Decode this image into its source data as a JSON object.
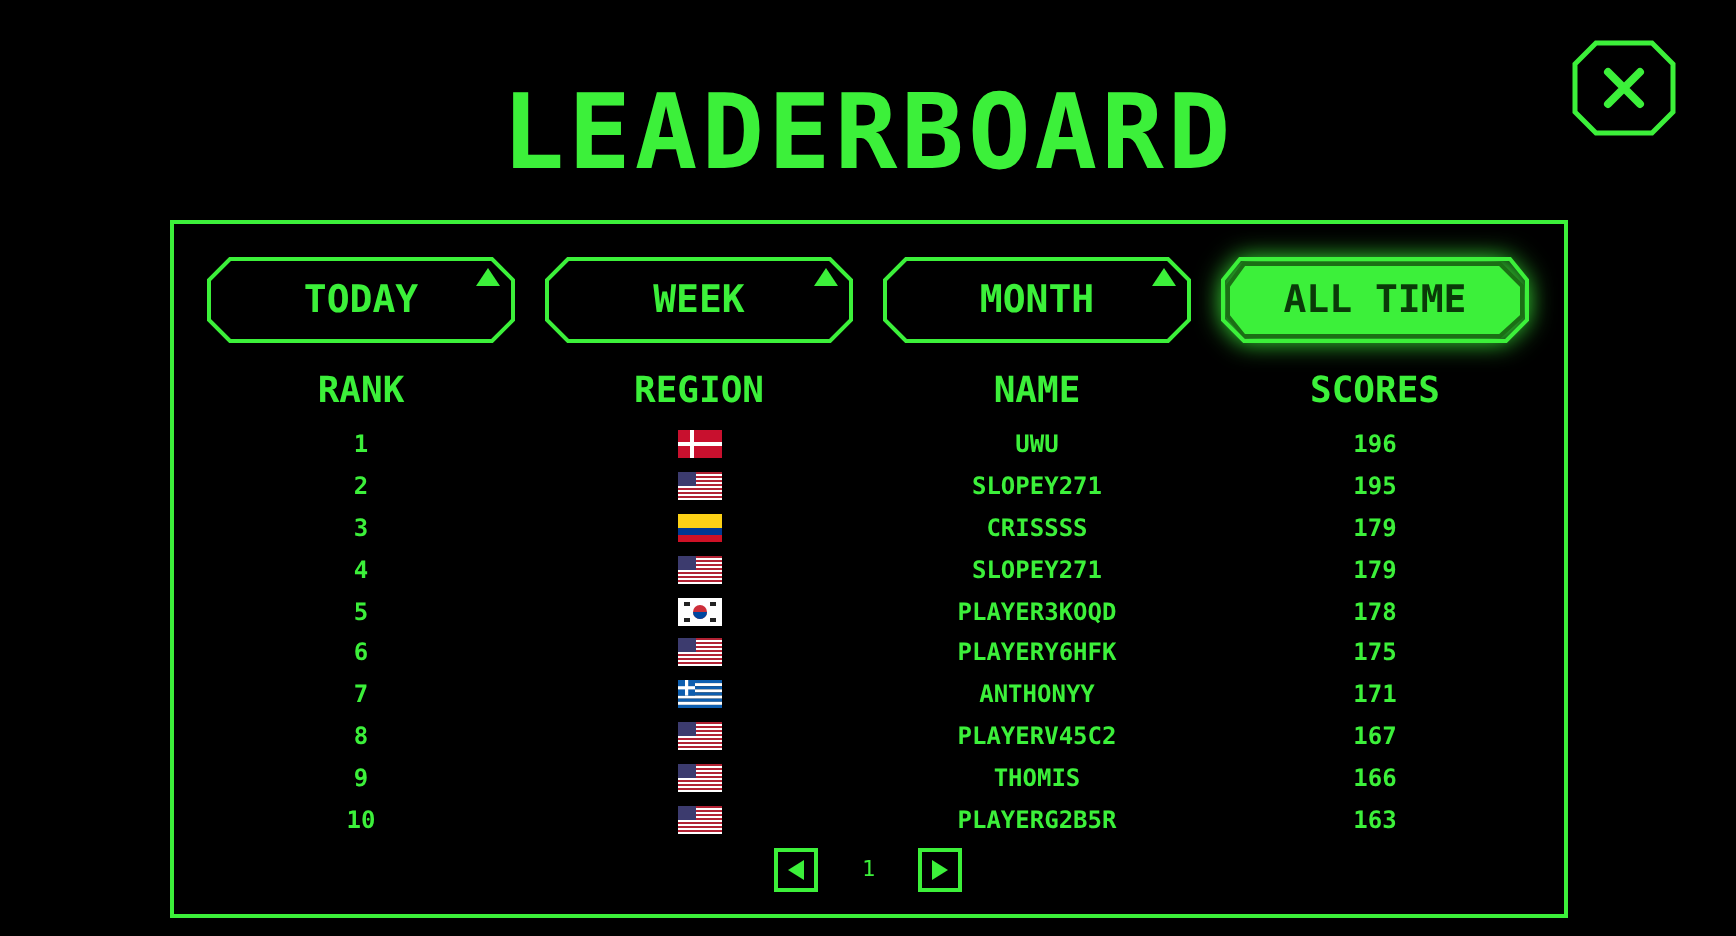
{
  "title": "LEADERBOARD",
  "tabs": [
    {
      "label": "TODAY",
      "selected": false
    },
    {
      "label": "WEEK",
      "selected": false
    },
    {
      "label": "MONTH",
      "selected": false
    },
    {
      "label": "ALL TIME",
      "selected": true
    }
  ],
  "columns": [
    "RANK",
    "REGION",
    "NAME",
    "SCORES"
  ],
  "rows": [
    {
      "rank": "1",
      "kind": "dk",
      "name": "UWU",
      "score": "196"
    },
    {
      "rank": "2",
      "kind": "us",
      "name": "SLOPEY271",
      "score": "195"
    },
    {
      "rank": "3",
      "kind": "co",
      "name": "CRISSSS",
      "score": "179"
    },
    {
      "rank": "4",
      "kind": "us",
      "name": "SLOPEY271",
      "score": "179"
    },
    {
      "rank": "5",
      "kind": "kr",
      "name": "PLAYER3KOQD",
      "score": "178"
    },
    {
      "rank": "6",
      "kind": "us",
      "name": "PLAYERY6HFK",
      "score": "175"
    },
    {
      "rank": "7",
      "kind": "gr",
      "name": "ANTHONYY",
      "score": "171"
    },
    {
      "rank": "8",
      "kind": "us",
      "name": "PLAYERV45C2",
      "score": "167"
    },
    {
      "rank": "9",
      "kind": "us",
      "name": "THOMIS",
      "score": "166"
    },
    {
      "rank": "10",
      "kind": "us",
      "name": "PLAYERG2B5R",
      "score": "163"
    }
  ],
  "page": "1"
}
